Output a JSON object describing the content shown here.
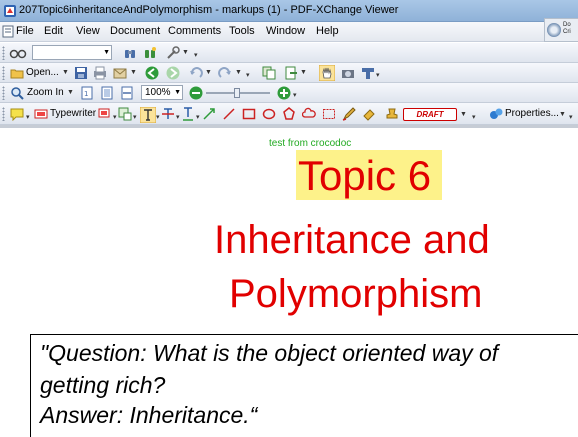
{
  "window": {
    "title": "207Topic6inheritanceAndPolymorphism - markups (1) - PDF-XChange Viewer"
  },
  "menu": {
    "items": [
      "File",
      "Edit",
      "View",
      "Document",
      "Comments",
      "Tools",
      "Window",
      "Help"
    ]
  },
  "badge": {
    "line1": "Do",
    "line2": "Cri"
  },
  "toolbar": {
    "open_label": "Open...",
    "zoom_in_label": "Zoom In",
    "zoom_value": "100%",
    "typewriter_label": "Typewriter",
    "stamp_label": "DRAFT",
    "properties_label": "Properties..."
  },
  "icons": {
    "app": "pdf-app-icon",
    "open": "folder-open-icon",
    "save": "save-icon",
    "print": "print-icon",
    "back": "back-arrow-icon",
    "forward": "forward-arrow-icon",
    "hand": "hand-tool-icon",
    "zoom": "magnifier-icon",
    "typewriter": "typewriter-icon",
    "properties": "properties-icon"
  },
  "colors": {
    "title_red": "#e10000",
    "highlight": "#fdf28a",
    "annotation_green": "#22aa22",
    "stamp_red": "#cc0000"
  },
  "document": {
    "annotation_text": "test from crocodoc",
    "topic_title": "Topic 6",
    "heading_line1": "Inheritance and",
    "heading_line2": "Polymorphism",
    "quote_line1": "\"Question: What is the object oriented way of",
    "quote_line2": "getting rich?",
    "quote_line3": "Answer: Inheritance.“"
  }
}
